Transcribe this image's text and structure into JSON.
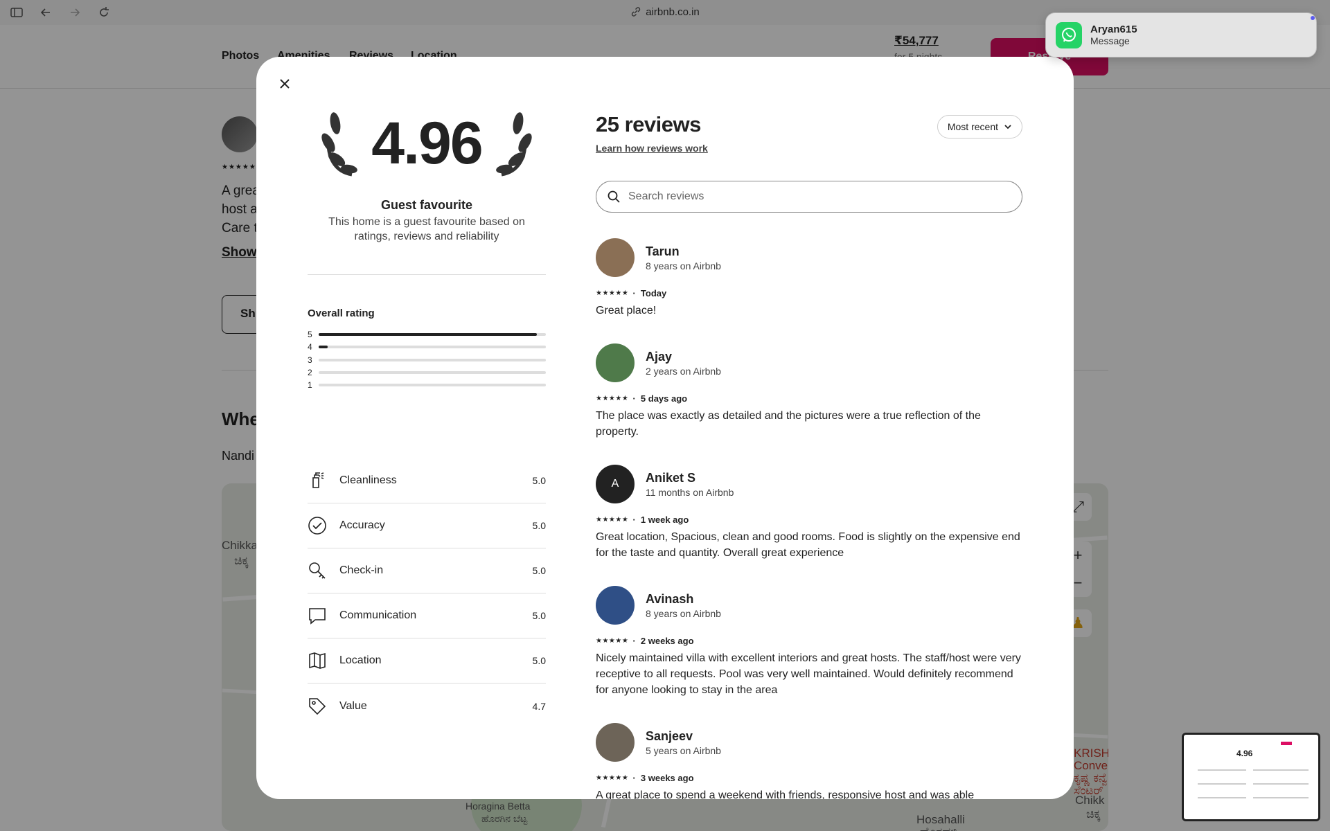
{
  "browser": {
    "url": "airbnb.co.in"
  },
  "page": {
    "subnav": [
      "Photos",
      "Amenities",
      "Reviews",
      "Location"
    ],
    "price": "₹54,777",
    "price_sub": "for 5 nights",
    "reserve_label": "Reserve",
    "bg_review_lines": [
      "A grea",
      "host a",
      "Care t"
    ],
    "bg_show": "Show",
    "bg_button": "Sh",
    "bg_heading": "Whe",
    "bg_location": "Nandi",
    "map_labels": {
      "left_top": "Chikka",
      "left_kn": "ಚಿಕ್ಕ",
      "right_top": "KRISH",
      "right_2": "Conver",
      "right_3": "ಕೃಷ್ಣ ಕನ್ವೆ",
      "right_4": "ಸೆಂಟರ್",
      "right_chikk": "Chikk",
      "right_chikk_kn": "ಚಿಕ್ಕ",
      "bottom_1": "Hosahalli",
      "bottom_kn": "ಹೊಸಹಳ್ಳಿ",
      "center_kn": "ಹೊರಗಿನ ಬೆಟ್ಟ",
      "center_en": "Horagina Betta"
    }
  },
  "notification": {
    "title": "Aryan615",
    "body": "Message",
    "app_icon": "whatsapp-icon"
  },
  "modal": {
    "score": "4.96",
    "guest_favourite_title": "Guest favourite",
    "guest_favourite_desc": "This home is a guest favourite based on ratings, reviews and reliability",
    "overall_title": "Overall rating",
    "distribution": [
      {
        "star": "5",
        "fraction": 0.96
      },
      {
        "star": "4",
        "fraction": 0.04
      },
      {
        "star": "3",
        "fraction": 0.0
      },
      {
        "star": "2",
        "fraction": 0.0
      },
      {
        "star": "1",
        "fraction": 0.0
      }
    ],
    "categories": [
      {
        "label": "Cleanliness",
        "value": "5.0",
        "icon": "spray-bottle-icon"
      },
      {
        "label": "Accuracy",
        "value": "5.0",
        "icon": "check-circle-icon"
      },
      {
        "label": "Check-in",
        "value": "5.0",
        "icon": "key-icon"
      },
      {
        "label": "Communication",
        "value": "5.0",
        "icon": "chat-bubble-icon"
      },
      {
        "label": "Location",
        "value": "5.0",
        "icon": "map-icon"
      },
      {
        "label": "Value",
        "value": "4.7",
        "icon": "price-tag-icon"
      }
    ],
    "reviews_count": "25 reviews",
    "learn_link": "Learn how reviews work",
    "sort_label": "Most recent",
    "search_placeholder": "Search reviews",
    "reviews": [
      {
        "name": "Tarun",
        "tenure": "8 years on Airbnb",
        "when": "Today",
        "text": "Great place!",
        "avatar_color": "#8a6f55",
        "initial": ""
      },
      {
        "name": "Ajay",
        "tenure": "2 years on Airbnb",
        "when": "5 days ago",
        "text": "The place was exactly as detailed and the pictures were a true reflection of the property.",
        "avatar_color": "#4f7a4a",
        "initial": ""
      },
      {
        "name": "Aniket S",
        "tenure": "11 months on Airbnb",
        "when": "1 week ago",
        "text": "Great location, Spacious, clean and good rooms. Food is slightly on the expensive end for the taste and quantity. Overall great experience",
        "avatar_color": "#222222",
        "initial": "A"
      },
      {
        "name": "Avinash",
        "tenure": "8 years on Airbnb",
        "when": "2 weeks ago",
        "text": "Nicely maintained villa with excellent interiors and great hosts. The staff/host were very receptive to all requests. Pool  was very well maintained. Would definitely recommend for anyone looking to stay in the area",
        "avatar_color": "#2f4f86",
        "initial": ""
      },
      {
        "name": "Sanjeev",
        "tenure": "5 years on Airbnb",
        "when": "3 weeks ago",
        "text": "A great place to spend a weekend with friends, responsive host and was able",
        "avatar_color": "#6d6458",
        "initial": ""
      }
    ],
    "stars": "★★★★★",
    "dot": "·"
  },
  "thumbnail": {
    "score": "4.96"
  }
}
